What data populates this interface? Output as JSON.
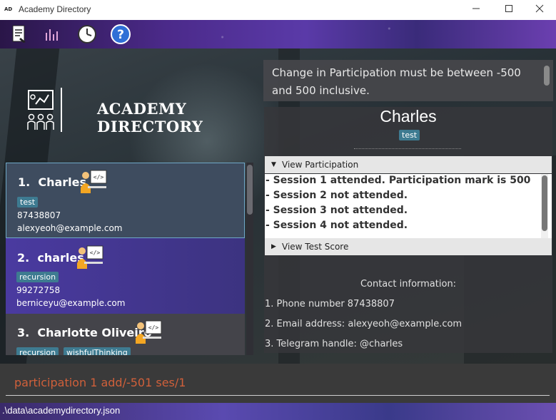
{
  "window": {
    "app_icon_text": "AD",
    "title": "Academy Directory",
    "controls": [
      "minimize",
      "maximize",
      "close"
    ]
  },
  "toolbar": {
    "icons": [
      "document-icon",
      "bar-chart-icon",
      "clock-icon",
      "help-icon"
    ]
  },
  "logo": {
    "text": "ACADEMY DIRECTORY"
  },
  "students": [
    {
      "index": "1.",
      "name": "Charles",
      "tags": [
        "test"
      ],
      "phone": "87438807",
      "email": "alexyeoh@example.com",
      "selected": true
    },
    {
      "index": "2.",
      "name": "charles",
      "tags": [
        "recursion"
      ],
      "phone": "99272758",
      "email": "berniceyu@example.com",
      "selected": false
    },
    {
      "index": "3.",
      "name": "Charlotte Oliveiro",
      "tags": [
        "recursion",
        "wishfulThinking"
      ],
      "phone": "",
      "email": "",
      "selected": false
    }
  ],
  "result": {
    "message": "Change in Participation must be between -500 and 500 inclusive."
  },
  "detail": {
    "name": "Charles",
    "tag": "test",
    "participation_header": "View Participation",
    "participation_rows": [
      "- Session 1 attended. Participation mark is 500",
      "- Session 2 not attended.",
      "- Session 3 not attended.",
      "- Session 4 not attended."
    ],
    "test_score_header": "View Test Score",
    "contact_title": "Contact information:",
    "contact_rows": [
      "1. Phone number 87438807",
      "2. Email address: alexyeoh@example.com",
      "3. Telegram handle: @charles"
    ]
  },
  "command": {
    "text": "participation 1 add/-501 ses/1",
    "color": "#d0603a"
  },
  "status": {
    "path": ".\\data\\academydirectory.json"
  },
  "colors": {
    "tag_bg": "#3e7b91",
    "toolbar_purple": "#4b2a8a",
    "selected_card": "#3e4c5f",
    "card2": "#4a3aa0"
  }
}
